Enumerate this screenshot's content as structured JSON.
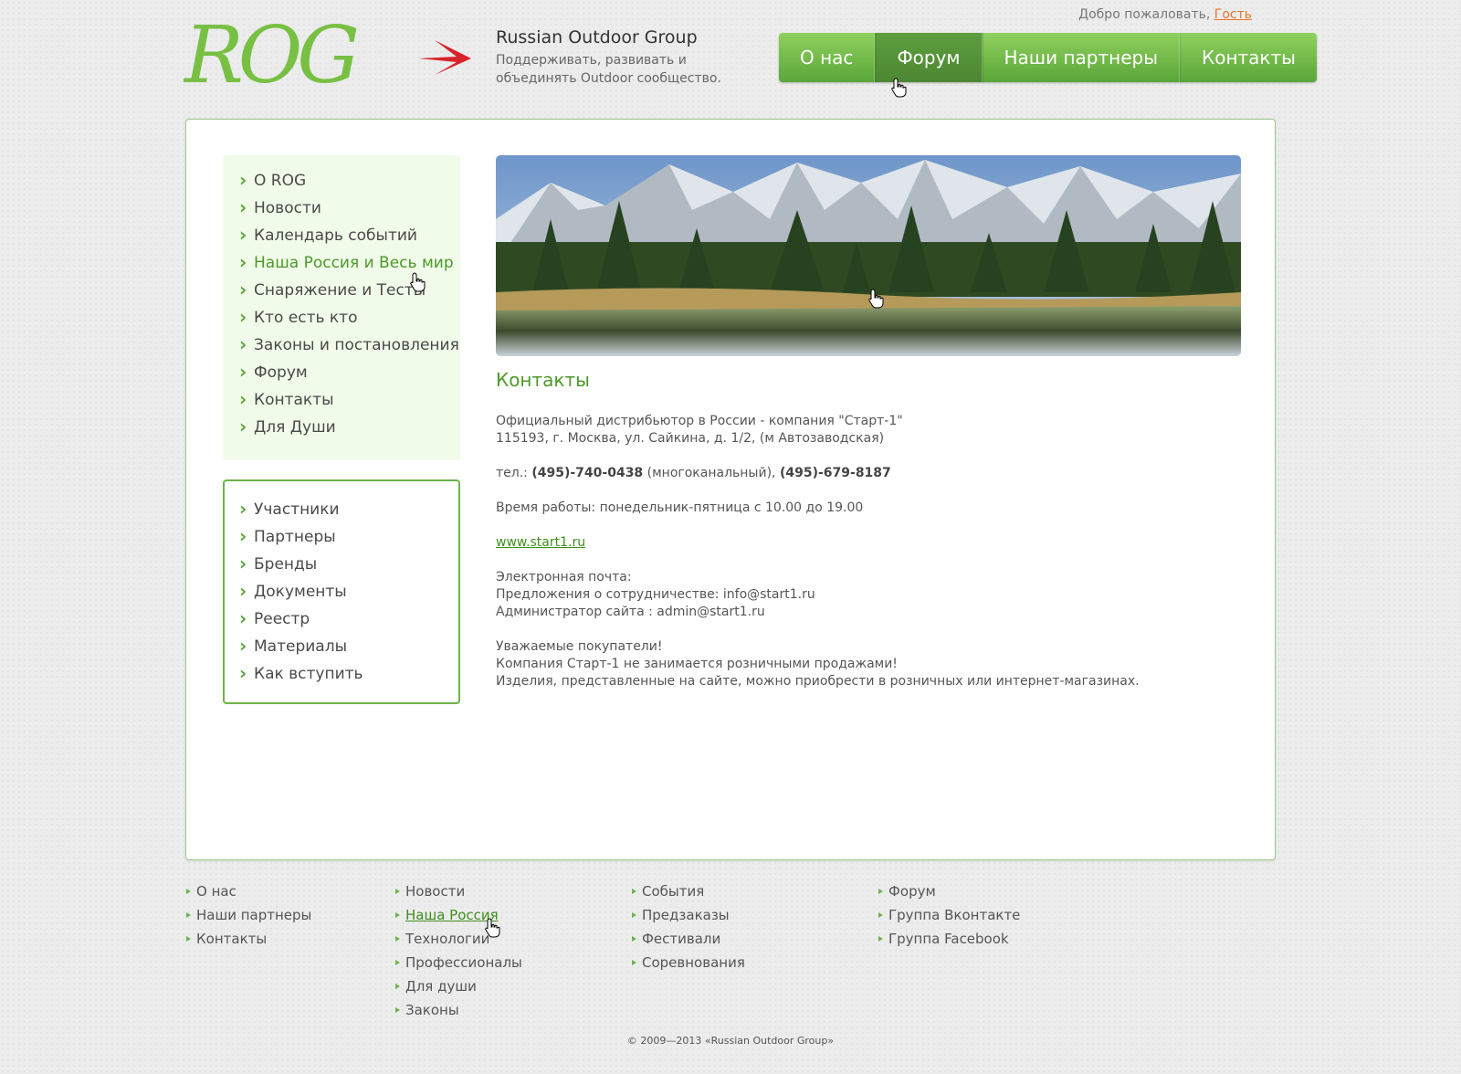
{
  "header": {
    "welcome_text": "Добро пожаловать,",
    "guest_link": "Гость",
    "site_name": "Russian Outdoor Group",
    "slogan": "Поддерживать, развивать и объединять Outdoor сообщество.",
    "logo_text": "ROG"
  },
  "top_nav": [
    "О нас",
    "Форум",
    "Наши партнеры",
    "Контакты"
  ],
  "side_menu_main": [
    "О ROG",
    "Новости",
    "Календарь событий",
    "Наша Россия и Весь мир",
    "Снаряжение и Тесты",
    "Кто есть кто",
    "Законы и постановления",
    "Форум",
    "Контакты",
    "Для Души"
  ],
  "side_menu_secondary": [
    "Участники",
    "Партнеры",
    "Бренды",
    "Документы",
    "Реестр",
    "Материалы",
    "Как вступить"
  ],
  "content": {
    "title": "Контакты",
    "distributor_line": "Официальный дистрибьютор в России - компания \"Старт-1\"",
    "address_line": "115193, г. Москва, ул. Сайкина, д. 1/2, (м Автозаводская)",
    "phone_prefix": "тел.:",
    "phone_1": "(495)-740-0438",
    "phone_1_note": "(многоканальный),",
    "phone_2": "(495)-679-8187",
    "hours": "Время работы: понедельник-пятница с 10.00 до 19.00",
    "website": "www.start1.ru",
    "email_heading": "Электронная почта:",
    "email_partnership": "Предложения о сотрудничестве: info@start1.ru",
    "email_admin": "Администратор сайта : admin@start1.ru",
    "notice_1": "Уважаемые покупатели!",
    "notice_2": "Компания Старт-1 не занимается розничными продажами!",
    "notice_3": "Изделия, представленные на сайте, можно приобрести в розничных или интернет-магазинах."
  },
  "footer": {
    "col1": [
      "О нас",
      "Наши партнеры",
      "Контакты"
    ],
    "col2": [
      "Новости",
      "Наша Россия",
      "Технологии",
      "Профессионалы",
      "Для души",
      "Законы"
    ],
    "col3": [
      "События",
      "Предзаказы",
      "Фестивали",
      "Соревнования"
    ],
    "col4": [
      "Форум",
      "Группа Вконтакте",
      "Группа Facebook"
    ],
    "copyright": "© 2009—2013 «Russian Outdoor Group»"
  },
  "colors": {
    "brand_green": "#6db34a",
    "link_orange": "#e8762b",
    "arrow_red": "#d8232a"
  }
}
